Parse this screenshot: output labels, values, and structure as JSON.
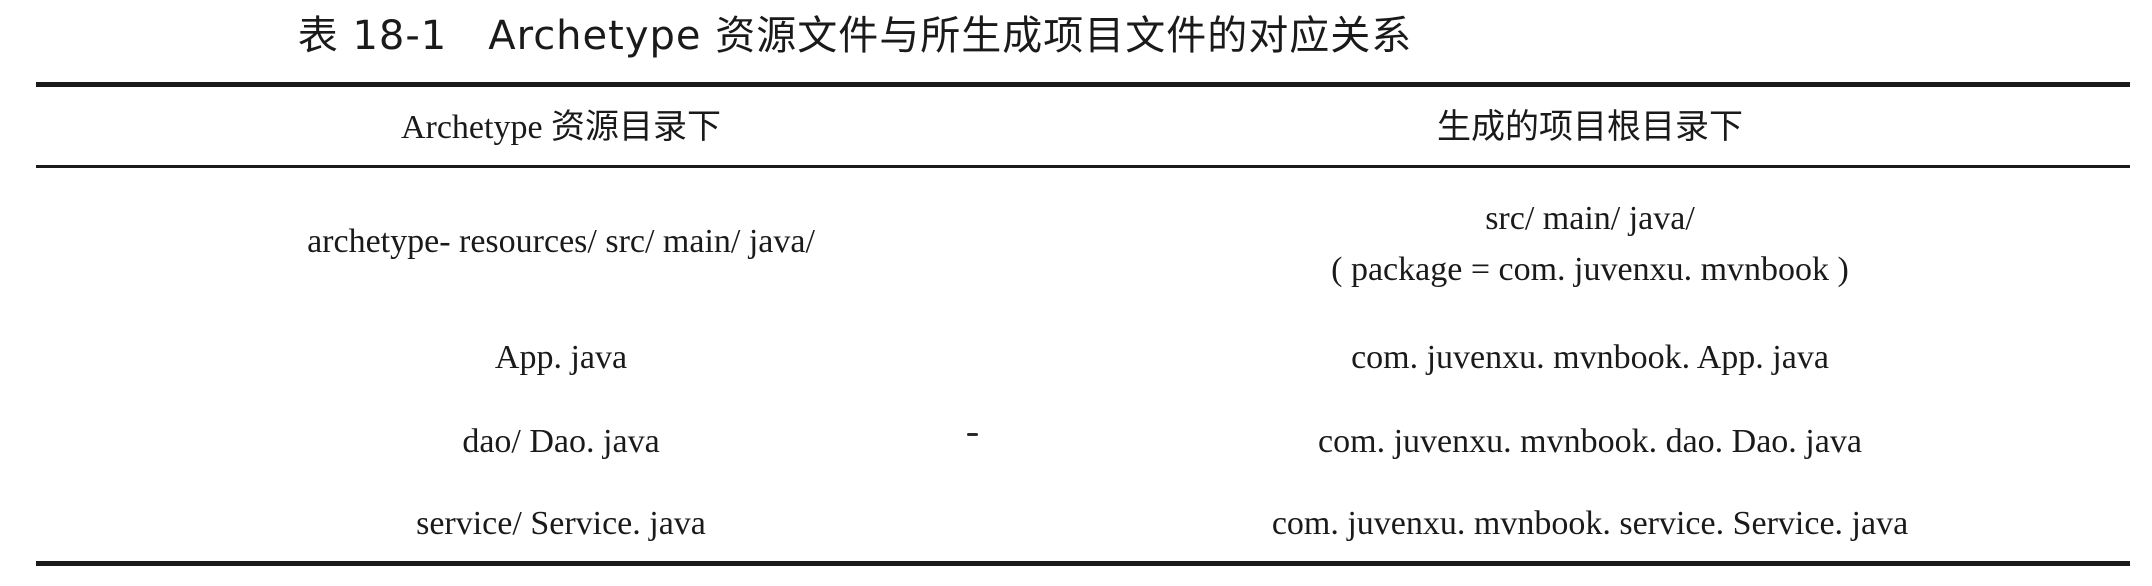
{
  "caption": "表 18-1　Archetype 资源文件与所生成项目文件的对应关系",
  "table": {
    "headers": [
      "Archetype 资源目录下",
      "生成的项目根目录下"
    ],
    "rows": [
      {
        "left": "archetype- resources/ src/ main/ java/",
        "right": [
          "src/ main/ java/",
          "( package  =  com. juvenxu. mvnbook )"
        ]
      },
      {
        "left": "App. java",
        "right": [
          "com. juvenxu. mvnbook. App. java"
        ]
      },
      {
        "left": "dao/ Dao. java",
        "right": [
          "com. juvenxu. mvnbook. dao. Dao. java"
        ]
      },
      {
        "left": "service/ Service. java",
        "right": [
          "com. juvenxu. mvnbook. service. Service. java"
        ]
      }
    ]
  }
}
